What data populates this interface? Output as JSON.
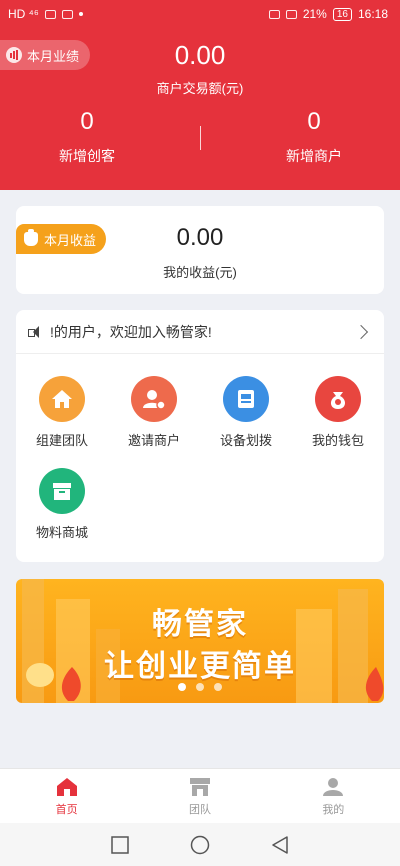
{
  "status_bar": {
    "left": "HD ⁴⁶",
    "battery": "21%",
    "time": "16:18"
  },
  "header": {
    "badge_label": "本月业绩",
    "main_amount": "0.00",
    "main_label": "商户交易额(元)",
    "stats": [
      {
        "value": "0",
        "label": "新增创客"
      },
      {
        "value": "0",
        "label": "新增商户"
      }
    ]
  },
  "earnings": {
    "tag_label": "本月收益",
    "amount": "0.00",
    "label": "我的收益(元)"
  },
  "notice": {
    "text": "!的用户，欢迎加入畅管家!"
  },
  "menu": [
    {
      "label": "组建团队",
      "icon": "home-icon",
      "color": "#f6a23a"
    },
    {
      "label": "邀请商户",
      "icon": "invite-user-icon",
      "color": "#ee6a4c"
    },
    {
      "label": "设备划拨",
      "icon": "device-transfer-icon",
      "color": "#3b8fe3"
    },
    {
      "label": "我的钱包",
      "icon": "wallet-icon",
      "color": "#e8463f"
    },
    {
      "label": "物料商城",
      "icon": "shop-box-icon",
      "color": "#21b57c"
    }
  ],
  "banner": {
    "line1": "畅管家",
    "line2": "让创业更简单"
  },
  "tabbar": [
    {
      "label": "首页",
      "icon": "home-tab-icon",
      "active": true
    },
    {
      "label": "团队",
      "icon": "store-tab-icon",
      "active": false
    },
    {
      "label": "我的",
      "icon": "person-tab-icon",
      "active": false
    }
  ],
  "colors": {
    "brand_red": "#e5323c",
    "tag_orange": "#f5a11b"
  }
}
